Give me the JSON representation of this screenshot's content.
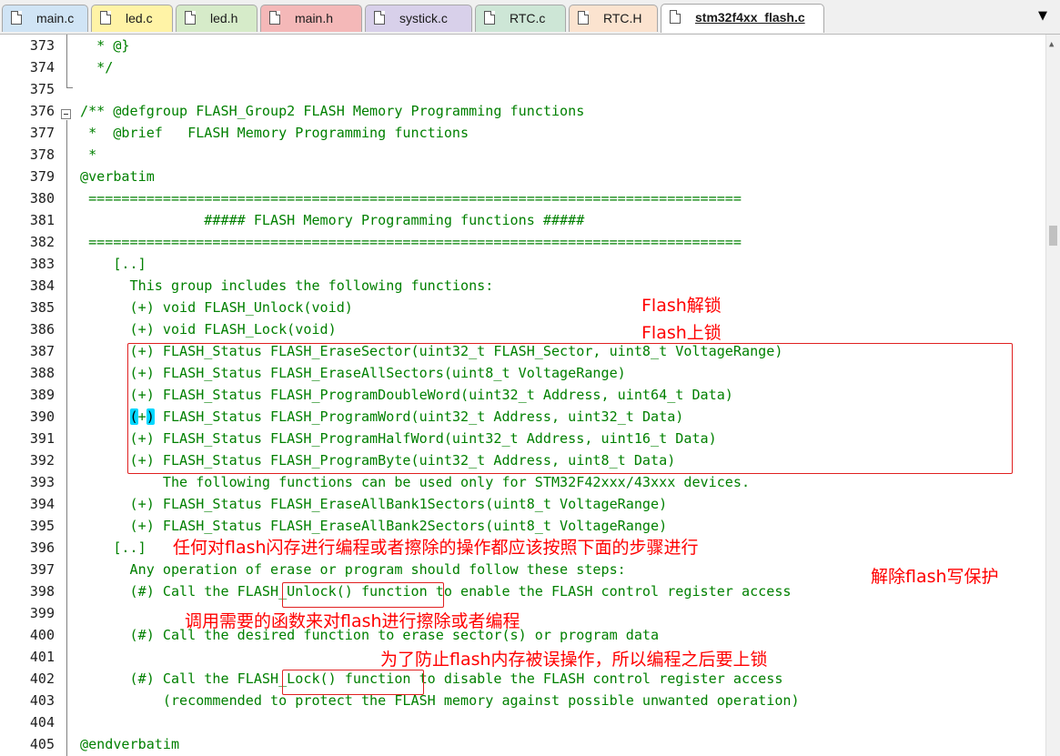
{
  "tabs": [
    {
      "label": "main.c",
      "color": "#d0e4f5"
    },
    {
      "label": "led.c",
      "color": "#fff3a6"
    },
    {
      "label": "led.h",
      "color": "#d6ebc9"
    },
    {
      "label": "main.h",
      "color": "#f4b8b8"
    },
    {
      "label": "systick.c",
      "color": "#d8d0ea"
    },
    {
      "label": "RTC.c",
      "color": "#cde6d6"
    },
    {
      "label": "RTC.H",
      "color": "#fbe3cf"
    },
    {
      "label": "stm32f4xx_flash.c",
      "color": "#ffffff",
      "active": true
    }
  ],
  "tab_menu_icon": "dropdown-triangle-icon",
  "lines": [
    {
      "n": "373",
      "text": "  * @}"
    },
    {
      "n": "374",
      "text": "  */"
    },
    {
      "n": "375",
      "text": ""
    },
    {
      "n": "376",
      "text": "/** @defgroup FLASH_Group2 FLASH Memory Programming functions"
    },
    {
      "n": "377",
      "text": " *  @brief   FLASH Memory Programming functions"
    },
    {
      "n": "378",
      "text": " *"
    },
    {
      "n": "379",
      "text": "@verbatim"
    },
    {
      "n": "380",
      "text": " ==============================================================================="
    },
    {
      "n": "381",
      "text": "               ##### FLASH Memory Programming functions #####"
    },
    {
      "n": "382",
      "text": " ==============================================================================="
    },
    {
      "n": "383",
      "text": "    [..]"
    },
    {
      "n": "384",
      "text": "      This group includes the following functions:"
    },
    {
      "n": "385",
      "text": "      (+) void FLASH_Unlock(void)"
    },
    {
      "n": "386",
      "text": "      (+) void FLASH_Lock(void)"
    },
    {
      "n": "387",
      "text": "      (+) FLASH_Status FLASH_EraseSector(uint32_t FLASH_Sector, uint8_t VoltageRange)"
    },
    {
      "n": "388",
      "text": "      (+) FLASH_Status FLASH_EraseAllSectors(uint8_t VoltageRange)"
    },
    {
      "n": "389",
      "text": "      (+) FLASH_Status FLASH_ProgramDoubleWord(uint32_t Address, uint64_t Data)"
    },
    {
      "n": "390",
      "text": "      (+) FLASH_Status FLASH_ProgramWord(uint32_t Address, uint32_t Data)"
    },
    {
      "n": "391",
      "text": "      (+) FLASH_Status FLASH_ProgramHalfWord(uint32_t Address, uint16_t Data)"
    },
    {
      "n": "392",
      "text": "      (+) FLASH_Status FLASH_ProgramByte(uint32_t Address, uint8_t Data)"
    },
    {
      "n": "393",
      "text": "          The following functions can be used only for STM32F42xxx/43xxx devices."
    },
    {
      "n": "394",
      "text": "      (+) FLASH_Status FLASH_EraseAllBank1Sectors(uint8_t VoltageRange)"
    },
    {
      "n": "395",
      "text": "      (+) FLASH_Status FLASH_EraseAllBank2Sectors(uint8_t VoltageRange)"
    },
    {
      "n": "396",
      "text": "    [..]"
    },
    {
      "n": "397",
      "text": "      Any operation of erase or program should follow these steps:"
    },
    {
      "n": "398",
      "text": "      (#) Call the FLASH_Unlock() function to enable the FLASH control register access"
    },
    {
      "n": "399",
      "text": ""
    },
    {
      "n": "400",
      "text": "      (#) Call the desired function to erase sector(s) or program data"
    },
    {
      "n": "401",
      "text": ""
    },
    {
      "n": "402",
      "text": "      (#) Call the FLASH_Lock() function to disable the FLASH control register access"
    },
    {
      "n": "403",
      "text": "          (recommended to protect the FLASH memory against possible unwanted operation)"
    },
    {
      "n": "404",
      "text": ""
    },
    {
      "n": "405",
      "text": "@endverbatim"
    }
  ],
  "annotations": {
    "unlock": "Flash解锁",
    "lock": "Flash上锁",
    "steps": "任何对flash闪存进行编程或者擦除的操作都应该按照下面的步骤进行",
    "remove_protect": "解除flash写保护",
    "call_func": "调用需要的函数来对flash进行擦除或者编程",
    "prevent": "为了防止flash内存被误操作，所以编程之后要上锁"
  },
  "colors": {
    "code_comment": "#008000",
    "annotation": "#ff0000",
    "cursor_highlight": "#00d7ff"
  }
}
